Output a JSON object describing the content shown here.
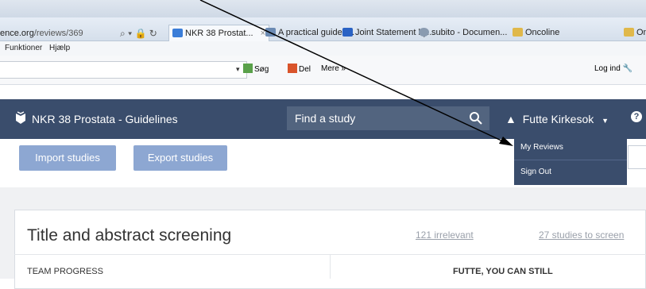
{
  "browser": {
    "address": {
      "host": "ence.org",
      "path": "/reviews/369"
    },
    "tabs": [
      {
        "label": "NKR 38 Prostat...",
        "active": true,
        "color": "#3b7dd8"
      },
      {
        "label": "A practical guide t...",
        "active": false,
        "color": "#6b8ab3"
      },
      {
        "label": "Joint Statement by...",
        "active": false,
        "color": "#2a62c4"
      },
      {
        "label": "subito - Documen...",
        "active": false,
        "color": "#8a9bb0"
      },
      {
        "label": "Oncoline",
        "active": false,
        "color": "#e0b84a"
      },
      {
        "label": "On",
        "active": false,
        "color": "#e0b84a"
      }
    ],
    "menu": {
      "functions": "Funktioner",
      "help": "Hjælp"
    },
    "commands": {
      "search": "Søg",
      "share": "Del",
      "more": "Mere »",
      "login": "Log ind"
    }
  },
  "nav": {
    "brand": "NKR 38 Prostata - Guidelines",
    "search_placeholder": "Find a study",
    "user": "Futte Kirkesok",
    "caret": "▼",
    "help": "?"
  },
  "dropdown": {
    "items": [
      "My Reviews",
      "Sign Out"
    ]
  },
  "toolbar": {
    "import": "Import studies",
    "export": "Export studies"
  },
  "panel": {
    "title": "Title and abstract screening",
    "irrelevant": "121 irrelevant",
    "to_screen": "27 studies to screen",
    "team_progress": "TEAM PROGRESS",
    "futte": "FUTTE, YOU CAN STILL"
  },
  "colors": {
    "navbar": "#3a4d6c",
    "button": "#8da7d2",
    "accent": "#3b7dd8"
  }
}
